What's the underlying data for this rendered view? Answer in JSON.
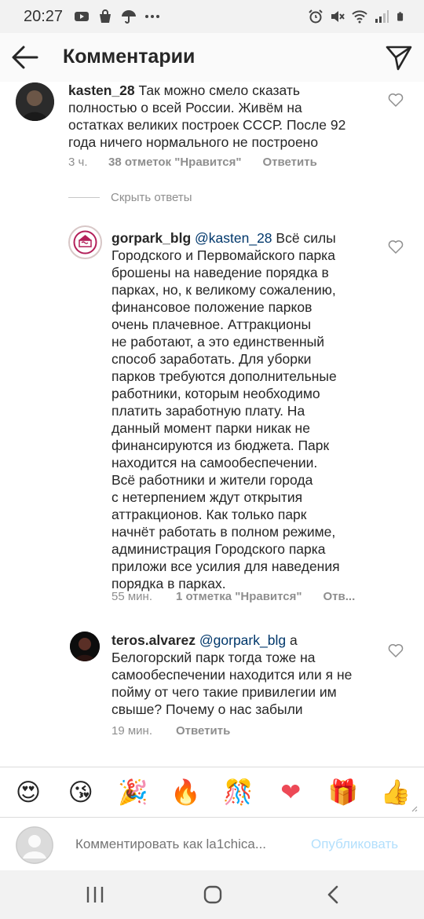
{
  "status_bar": {
    "time": "20:27",
    "left_icons": [
      "youtube-icon",
      "bag-icon",
      "umbrella-icon",
      "more-dots-icon"
    ],
    "right_icons": [
      "alarm-icon",
      "mute-icon",
      "wifi-icon",
      "signal-icon",
      "battery-icon"
    ]
  },
  "header": {
    "title": "Комментарии",
    "back_icon": "arrow-left-icon",
    "send_icon": "paper-plane-icon"
  },
  "comments": [
    {
      "username": "kasten_28",
      "text": "Так можно смело сказать полностью о всей России. Живём на остатках великих построек СССР. После 92 года ничего нормального не построено",
      "lines": [
        "Так можно смело сказать",
        "полностью о всей России. Живём на",
        "остатках великих построек СССР. После 92",
        "года ничего нормального не построено"
      ],
      "time": "3 ч.",
      "likes": "38 отметок \"Нравится\"",
      "reply": "Ответить"
    },
    {
      "hide_replies": "Скрыть ответы"
    },
    {
      "username": "gorpark_blg",
      "mention": "@kasten_28",
      "lines": [
        "Всё силы",
        "Городского и Первомайского парка",
        "брошены на наведение порядка в",
        "парках, но, к великому сожалению,",
        "финансовое положение парков",
        "очень плачевное. Аттракционы",
        "не работают, а это единственный",
        "способ заработать. Для уборки",
        "парков требуются дополнительные",
        "работники, которым необходимо",
        "платить заработную плату. На",
        "данный момент парки никак не",
        "финансируются из бюджета. Парк",
        "находится на самообеспечении.",
        "Всё работники и жители города",
        "с нетерпением ждут открытия",
        "аттракционов. Как только парк",
        "начнёт работать в полном режиме,",
        "администрация Городского парка",
        "приложи все усилия для наведения",
        "порядка в парках."
      ],
      "time": "55 мин.",
      "likes": "1 отметка \"Нравится\"",
      "reply": "Отв..."
    },
    {
      "username": "teros.alvarez",
      "mention": "@gorpark_blg",
      "lines": [
        "а",
        "Белогорский парк тогда тоже на",
        "самообеспечении находится или я не",
        "пойму от чего такие привилегии им",
        "свыше? Почему о нас забыли"
      ],
      "time": "19 мин.",
      "reply": "Ответить"
    }
  ],
  "emoji_bar": [
    "😍",
    "😘",
    "🎉",
    "🔥",
    "🎊",
    "❤",
    "🎁",
    "👍"
  ],
  "composer": {
    "placeholder": "Комментировать как la1chica...",
    "publish": "Опубликовать"
  },
  "nav_bar": [
    "recent-apps-icon",
    "home-icon",
    "back-icon"
  ],
  "colors": {
    "mention": "#00376b",
    "meta": "#8e8e8e",
    "publish_disabled": "#b2dffc",
    "heart_love": "#ed4956"
  }
}
